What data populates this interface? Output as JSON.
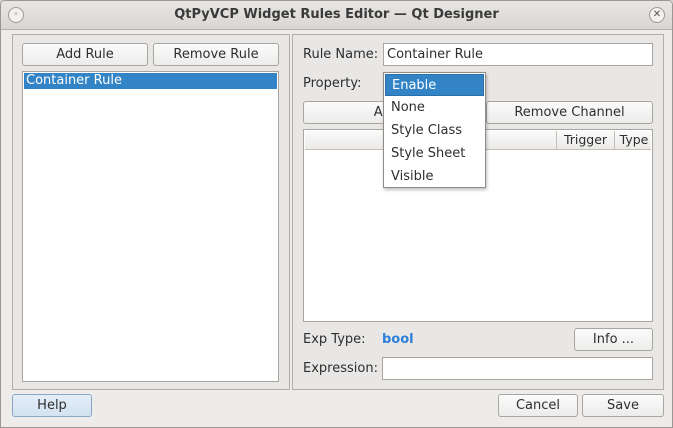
{
  "window": {
    "title": "QtPyVCP Widget Rules Editor — Qt Designer",
    "menu_glyph": "◦",
    "close_glyph": "✕"
  },
  "left_panel": {
    "add_rule_label": "Add Rule",
    "remove_rule_label": "Remove Rule",
    "rules": [
      {
        "label": "Container Rule",
        "selected": true
      }
    ]
  },
  "right_panel": {
    "rule_name_label": "Rule Name:",
    "rule_name_value": "Container Rule",
    "property_label": "Property:",
    "add_channel_label": "Add C",
    "remove_channel_label": "Remove Channel",
    "table": {
      "columns": [
        "",
        "Trigger",
        "Type"
      ],
      "rows": []
    },
    "exp_type_label": "Exp Type:",
    "exp_type_value": "bool",
    "info_label": "Info ...",
    "expression_label": "Expression:",
    "expression_value": ""
  },
  "property_dropdown": {
    "selected": "Enable",
    "options": [
      "Enable",
      "None",
      "Style Class",
      "Style Sheet",
      "Visible"
    ]
  },
  "footer": {
    "help_label": "Help",
    "cancel_label": "Cancel",
    "save_label": "Save"
  },
  "colors": {
    "selection": "#3284c6",
    "exp_type_value": "#2f7fd6",
    "window_bg": "#edeceb"
  }
}
